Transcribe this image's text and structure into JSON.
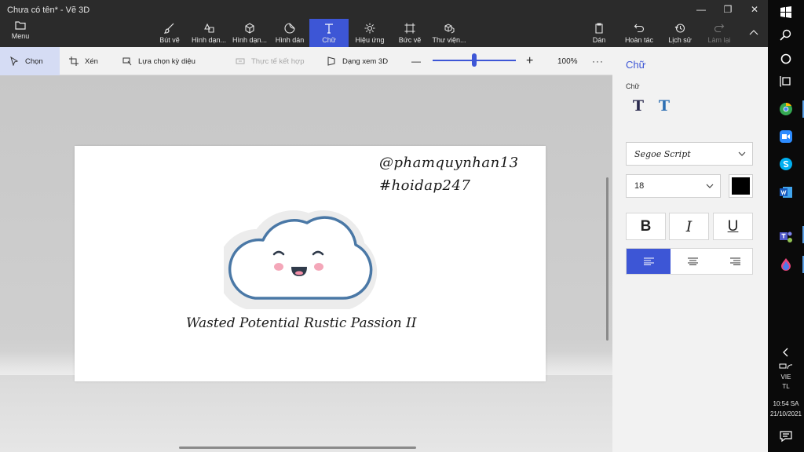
{
  "window": {
    "title": "Chưa có tên* - Vẽ 3D",
    "controls": [
      "—",
      "❐",
      "✕"
    ]
  },
  "ribbon": {
    "menu_label": "Menu",
    "tools": [
      {
        "label": "Bút vẽ",
        "icon": "brush-icon"
      },
      {
        "label": "Hình dạn...",
        "icon": "2d-shapes-icon"
      },
      {
        "label": "Hình dạn...",
        "icon": "3d-shapes-icon"
      },
      {
        "label": "Hình dán",
        "icon": "stickers-icon"
      },
      {
        "label": "Chữ",
        "icon": "text-icon",
        "active": true
      },
      {
        "label": "Hiệu ứng",
        "icon": "effects-icon"
      },
      {
        "label": "Bức vẽ",
        "icon": "canvas-icon"
      },
      {
        "label": "Thư viện...",
        "icon": "3d-library-icon"
      }
    ],
    "right": [
      {
        "label": "Dán",
        "icon": "paste-icon"
      },
      {
        "label": "Hoàn tác",
        "icon": "undo-icon"
      },
      {
        "label": "Lịch sử",
        "icon": "history-icon"
      },
      {
        "label": "Làm lại",
        "icon": "redo-icon",
        "disabled": true
      }
    ]
  },
  "commandbar": {
    "select": "Chọn",
    "crop": "Xén",
    "magic_select": "Lựa chọn kỳ diệu",
    "mixed_reality": "Thực tế kết hợp",
    "view_3d": "Dạng xem 3D",
    "zoom_minus": "—",
    "zoom_plus": "+",
    "zoom_value": "100%",
    "zoom_fraction": 0.5,
    "more": "···"
  },
  "canvas": {
    "handle": "@phamquynhan13",
    "hashtag": "#hoidap247",
    "caption": "Wasted Potential Rustic Passion II",
    "sticker": "smiling-cloud"
  },
  "panel": {
    "title": "Chữ",
    "section_label": "Chữ",
    "text_types": [
      {
        "glyph": "T",
        "icon": "2d-text-icon"
      },
      {
        "glyph": "T",
        "icon": "3d-text-icon"
      }
    ],
    "font": "Segoe Script",
    "size": "18",
    "color": "#000000",
    "format": {
      "bold": "B",
      "italic": "I",
      "underline": "U"
    },
    "alignment": [
      "left",
      "center",
      "right"
    ],
    "active_alignment": "left"
  },
  "taskbar": {
    "language": "VIE",
    "input_mode": "TL",
    "time": "10:54 SA",
    "date": "21/10/2021"
  },
  "colors": {
    "accent": "#3d56d6",
    "ribbon_bg": "#2b2b2b",
    "panel_bg": "#f2f2f2",
    "cloud_outline": "#4a78a6",
    "cheek": "#f4a7b9"
  }
}
